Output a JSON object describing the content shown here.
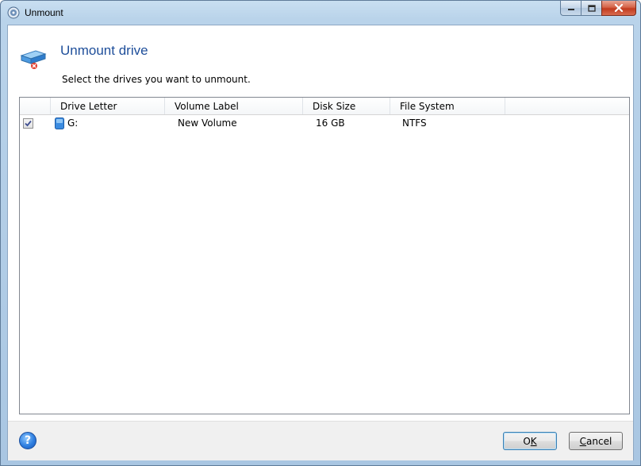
{
  "window": {
    "title": "Unmount",
    "minimize_label": "minimize",
    "maximize_label": "maximize",
    "close_label": "close"
  },
  "header": {
    "title": "Unmount drive",
    "subtitle": "Select the drives you want to unmount."
  },
  "table": {
    "columns": [
      "Drive Letter",
      "Volume Label",
      "Disk Size",
      "File System"
    ],
    "rows": [
      {
        "checked": true,
        "drive_letter": "G:",
        "volume_label": "New Volume",
        "disk_size": "16 GB",
        "file_system": "NTFS"
      }
    ]
  },
  "footer": {
    "help_label": "?",
    "ok_label": "OK",
    "ok_mnemonic": "K",
    "cancel_label": "Cancel",
    "cancel_mnemonic": "C"
  },
  "colors": {
    "title_accent": "#1e4e9a",
    "close_button": "#c13b1f"
  }
}
